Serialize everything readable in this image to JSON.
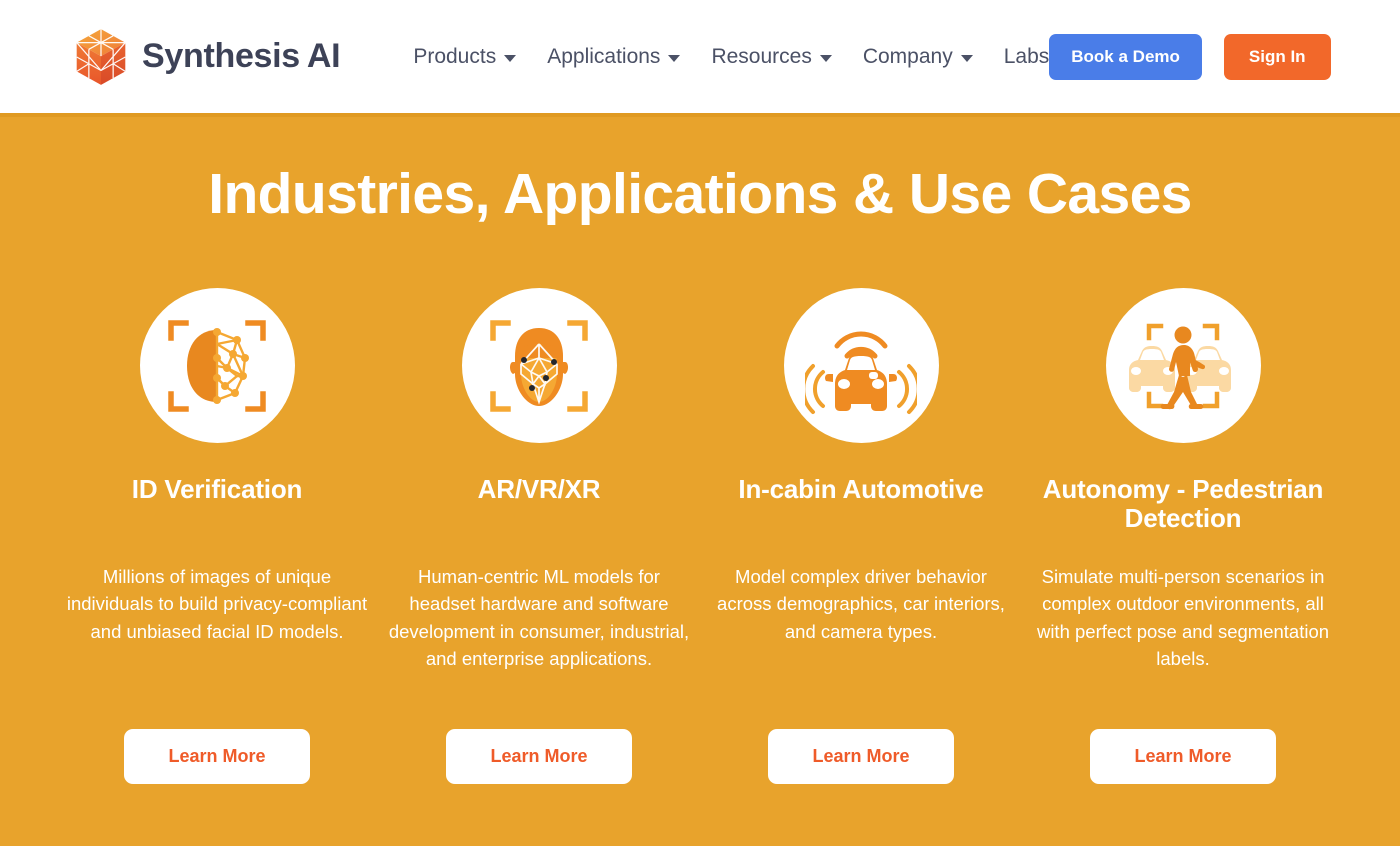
{
  "header": {
    "brand": {
      "name": "Synthesis",
      "suffix": "AI",
      "logo_icon": "hexagon-cube-logo"
    },
    "nav": [
      {
        "label": "Products",
        "has_dropdown": true
      },
      {
        "label": "Applications",
        "has_dropdown": true
      },
      {
        "label": "Resources",
        "has_dropdown": true
      },
      {
        "label": "Company",
        "has_dropdown": true
      },
      {
        "label": "Labs",
        "has_dropdown": false
      }
    ],
    "actions": {
      "demo_label": "Book a Demo",
      "demo_color": "#4a7de8",
      "signin_label": "Sign In",
      "signin_color": "#f2682a"
    }
  },
  "hero": {
    "title": "Industries, Applications & Use Cases",
    "background_color": "#e8a32c",
    "text_color": "#ffffff"
  },
  "cards": [
    {
      "icon": "face-profile-mesh-icon",
      "title": "ID Verification",
      "description": "Millions of images of unique individuals to build privacy-compliant and unbiased facial ID models.",
      "button_label": "Learn More"
    },
    {
      "icon": "face-front-wireframe-icon",
      "title": "AR/VR/XR",
      "description": "Human-centric ML models for headset hardware and software development in consumer, industrial, and enterprise applications.",
      "button_label": "Learn More"
    },
    {
      "icon": "car-sensor-icon",
      "title": "In-cabin Automotive",
      "description": "Model complex driver behavior across demographics, car interiors, and camera types.",
      "button_label": "Learn More"
    },
    {
      "icon": "pedestrian-detection-icon",
      "title": "Autonomy - Pedestrian Detection",
      "description": "Simulate multi-person scenarios in complex outdoor environments, all with perfect pose and segmentation labels.",
      "button_label": "Learn More"
    }
  ],
  "colors": {
    "icon_orange": "#ef8b22",
    "icon_orange_light": "#f5a833",
    "icon_orange_pale": "#fbd9a3",
    "learn_more_text": "#ef5b29",
    "brand_text": "#3d4257"
  }
}
